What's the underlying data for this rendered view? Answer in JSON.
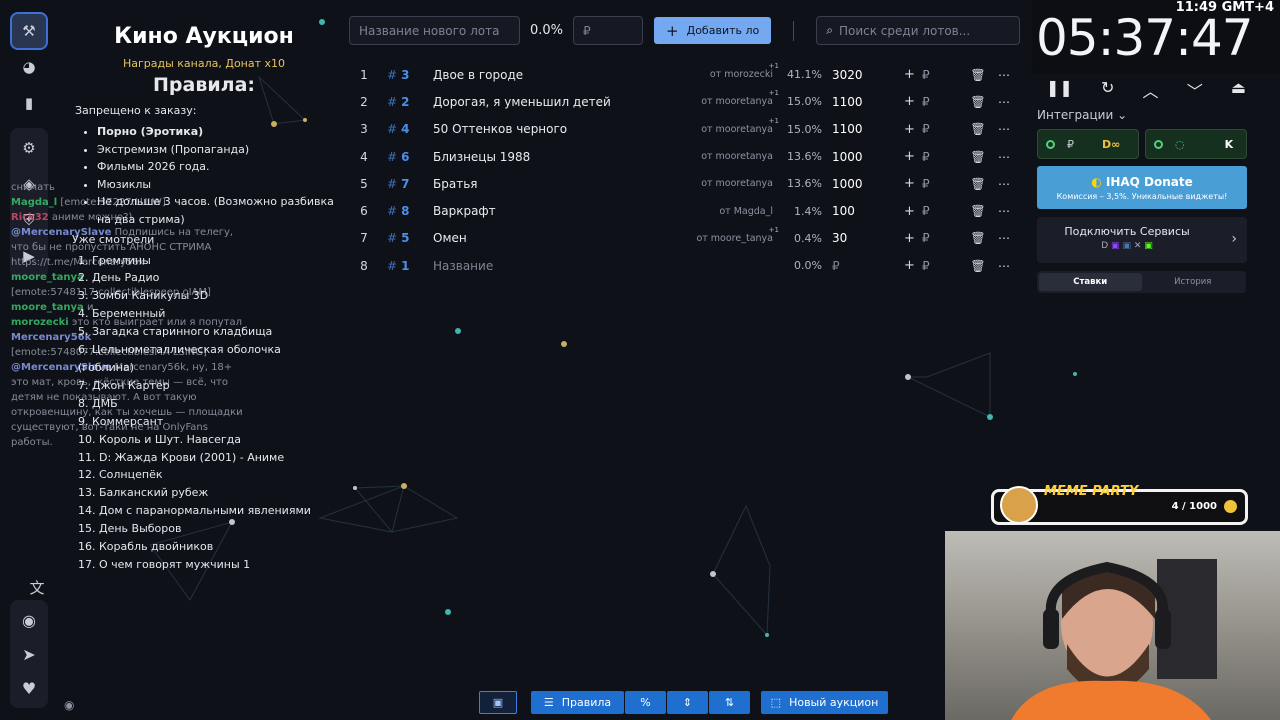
{
  "rules": {
    "title": "Кино Аукцион",
    "subtitle": "Награды канала, Донат х10",
    "heading": "Правила:",
    "forbidden_title": "Запрещено к заказу:",
    "forbidden": [
      "Порно (Эротика)",
      "Экстремизм (Пропаганда)",
      "Фильмы 2026 года.",
      "Мюзиклы",
      "Не дольше 3 часов. (Возможно разбивка на два стрима)"
    ],
    "watched_title": "Уже смотрели",
    "watched": [
      "1. Гремлины",
      "2. День Радио",
      "3. Зомби Каникулы 3D",
      "4. Беременный",
      "5. Загадка старинного кладбища",
      "6. Цельнометаллическая оболочка (гоблина)",
      "7. Джон Картер",
      "8. ДМБ",
      "9. Коммерсант",
      "10. Король и Шут. Навсегда",
      "11. D: Жажда Крови (2001) - Аниме",
      "12. Солнцепёк",
      "13. Балканский рубеж",
      "14. Дом с паранормальными явлениями",
      "15. День Выборов",
      "16. Корабль двойников",
      "17. О чем говорят мужчины 1"
    ]
  },
  "chat": [
    {
      "user": "",
      "text": "снимать"
    },
    {
      "user": "Magda_l",
      "text": "[emote:37227:LULW]"
    },
    {
      "user": "Rick32",
      "text": "аниме можно?)"
    },
    {
      "user": "@MercenarySlave",
      "text": "Подпишись на телегу, что бы не пропустить АНОНС СТРИМА https://t.me/Mercenary56k"
    },
    {
      "user": "moore_tanya",
      "text": "[emote:5748117:collectiblespeep oIAM]"
    },
    {
      "user": "moore_tanya",
      "text": "и"
    },
    {
      "user": "morozecki",
      "text": "это кто выиграет или я попутал"
    },
    {
      "user": "Mercenary56k",
      "text": "[emote:5748077:collectiblesMA LSING]"
    },
    {
      "user": "@MercenarySlave",
      "text": "Mercenary56k, ну, 18+ это мат, кровь, жёсткие темы — всё, что детям не показывают. А вот такую откровенщину, как ты хочешь — площадки существуют, вот-таки не на OnlyFans работы."
    }
  ],
  "topbar": {
    "lot_placeholder": "Название нового лота",
    "percent": "0.0%",
    "price_placeholder": "₽",
    "add_label": "Добавить ло",
    "search_placeholder": "Поиск среди лотов..."
  },
  "lots": [
    {
      "n": "1",
      "id": "3",
      "name": "Двое в городе",
      "by": "от morozecki",
      "plus": "+1",
      "pct": "41.1%",
      "amount": "3020"
    },
    {
      "n": "2",
      "id": "2",
      "name": "Дорогая, я уменьшил детей",
      "by": "от mooretanya",
      "plus": "+1",
      "pct": "15.0%",
      "amount": "1100"
    },
    {
      "n": "3",
      "id": "4",
      "name": "50 Оттенков черного",
      "by": "от mooretanya",
      "plus": "+1",
      "pct": "15.0%",
      "amount": "1100"
    },
    {
      "n": "4",
      "id": "6",
      "name": "Близнецы 1988",
      "by": "от mooretanya",
      "plus": "",
      "pct": "13.6%",
      "amount": "1000"
    },
    {
      "n": "5",
      "id": "7",
      "name": "Братья",
      "by": "от mooretanya",
      "plus": "",
      "pct": "13.6%",
      "amount": "1000"
    },
    {
      "n": "6",
      "id": "8",
      "name": "Варкрафт",
      "by": "от Magda_l",
      "plus": "",
      "pct": "1.4%",
      "amount": "100"
    },
    {
      "n": "7",
      "id": "5",
      "name": "Омен",
      "by": "от moore_tanya",
      "plus": "+1",
      "pct": "0.4%",
      "amount": "30"
    },
    {
      "n": "8",
      "id": "1",
      "name": "Название",
      "by": "",
      "plus": "",
      "pct": "0.0%",
      "amount": "₽"
    }
  ],
  "timer": {
    "value": "05:37:47",
    "clock": "11:49 GMT+4"
  },
  "integrations": {
    "label": "Интеграции",
    "donate_title": "IHAQ Donate",
    "donate_sub": "Комиссия – 3,5%. Уникальные виджеты!",
    "services_title": "Подключить Сервисы",
    "tabs": [
      "Ставки",
      "История"
    ]
  },
  "meme": {
    "label": "MEME PARTY",
    "count": "4 / 1000"
  },
  "bottom": {
    "rules_label": "Правила",
    "new_auction_label": "Новый аукцион"
  },
  "colors": {
    "accent": "#4c8ee8",
    "button_blue": "#1f6fd0",
    "gold": "#e8c35a"
  }
}
